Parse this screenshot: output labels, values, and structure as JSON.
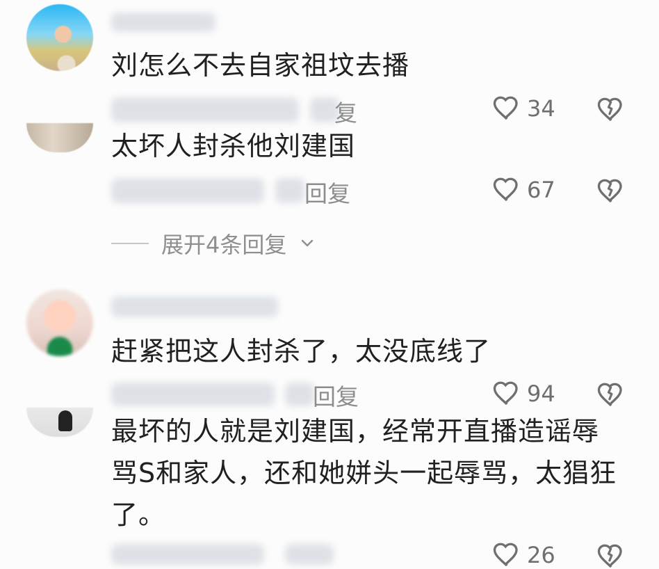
{
  "comments": [
    {
      "text": "刘怎么不去自家祖坟去播",
      "reply_label": "复",
      "likes": "34"
    },
    {
      "text": "太坏人封杀他刘建国",
      "reply_label": "回复",
      "likes": "67"
    },
    {
      "text": "赶紧把这人封杀了，太没底线了",
      "reply_label": "回复",
      "likes": "94"
    },
    {
      "text": "最坏的人就是刘建国，经常开直播造谣辱\n骂S和家人，还和她姘头一起辱骂，太猖狂\n了。",
      "reply_label": "",
      "likes": "26"
    }
  ],
  "expand_replies": {
    "label": "展开4条回复"
  },
  "icons": {
    "like": "heart-icon",
    "dislike": "broken-heart-icon",
    "expand": "chevron-down-icon"
  },
  "colors": {
    "text": "#202020",
    "meta": "#8d8d8d",
    "icon": "#6f6f6f",
    "background": "#fcfcfc"
  }
}
